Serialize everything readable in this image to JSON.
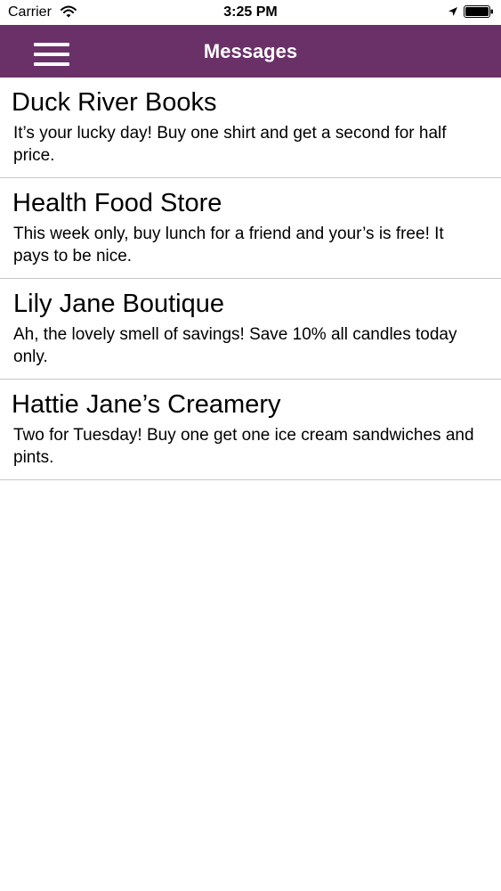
{
  "status_bar": {
    "carrier": "Carrier",
    "time": "3:25 PM",
    "icons": [
      "wifi-icon",
      "location-icon",
      "battery-icon"
    ]
  },
  "nav": {
    "title": "Messages",
    "menu_icon": "hamburger-menu-icon",
    "background_color": "#6a3068"
  },
  "messages": [
    {
      "sender": "Duck River Books",
      "body": "It’s your lucky day! Buy one shirt and get a second for half price."
    },
    {
      "sender": "Health Food Store",
      "body": "This week only, buy lunch for a friend and your’s is free! It pays to be nice."
    },
    {
      "sender": "Lily Jane Boutique",
      "body": "Ah, the lovely smell of savings! Save 10% all candles today only."
    },
    {
      "sender": "Hattie Jane’s Creamery",
      "body": "Two for Tuesday! Buy one get one ice cream sandwiches and pints."
    }
  ]
}
